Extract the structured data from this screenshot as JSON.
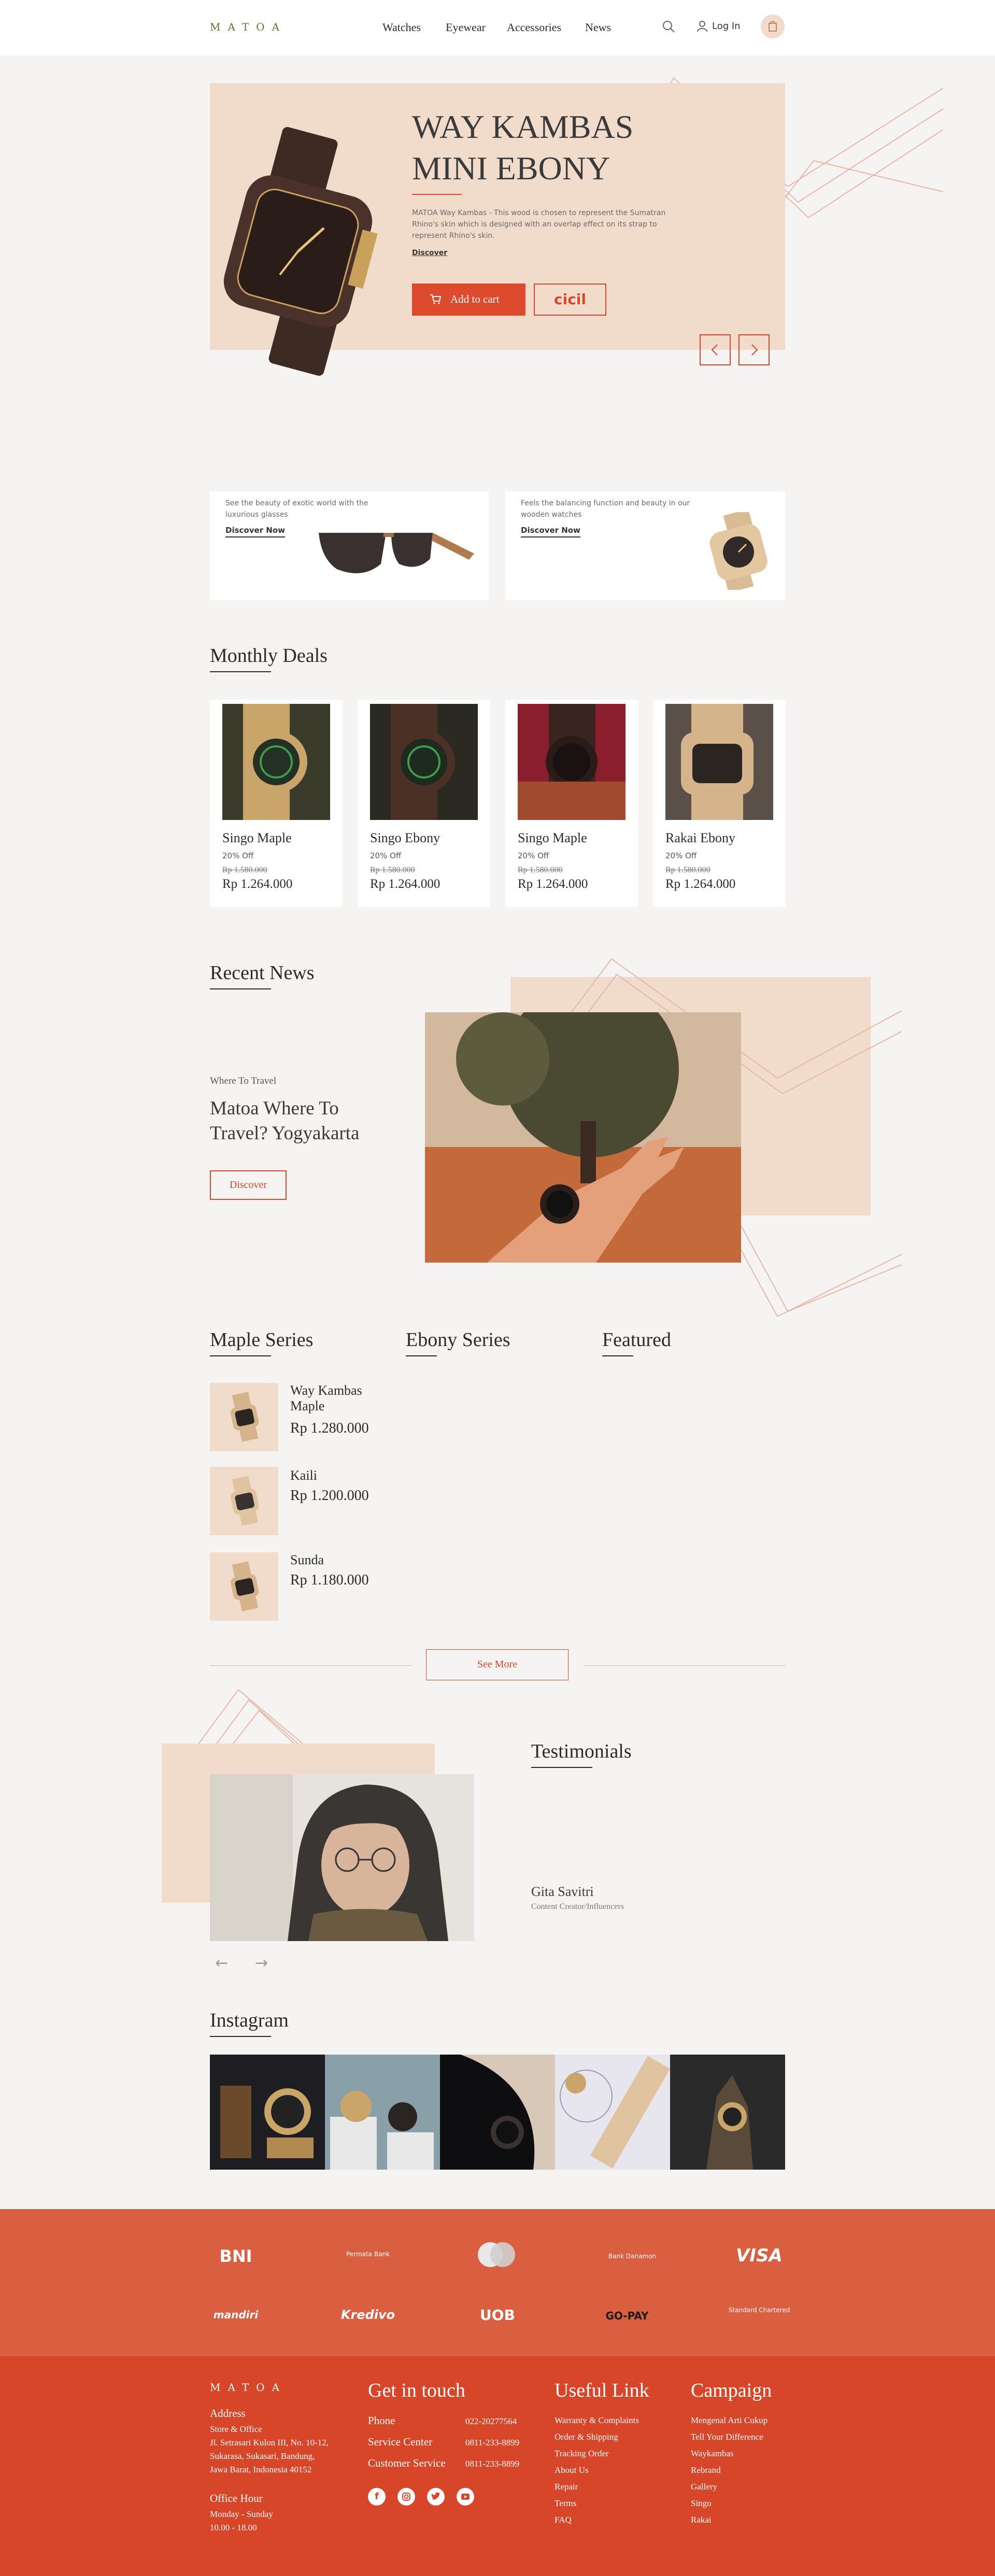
{
  "header": {
    "logo": "MATOA",
    "nav": [
      "Watches",
      "Eyewear",
      "Accessories",
      "News"
    ],
    "login": "Log In"
  },
  "hero": {
    "title_line1": "WAY KAMBAS",
    "title_line2": "MINI EBONY",
    "description": "MATOA Way Kambas - This wood is chosen to represent the Sumatran Rhino's skin which is designed with an overlap effect on its strap to represent Rhino's skin.",
    "discover": "Discover",
    "add_to_cart": "Add to cart",
    "cicil": "cicil"
  },
  "promos": [
    {
      "text": "See the beauty of exotic world with the luxurious glasses",
      "link": "Discover Now"
    },
    {
      "text": "Feels the balancing function and beauty in our wooden watches",
      "link": "Discover Now"
    }
  ],
  "monthly_deals": {
    "title": "Monthly Deals",
    "items": [
      {
        "name": "Singo Maple",
        "discount": "20% Off",
        "old_price": "Rp 1.580.000",
        "price": "Rp 1.264.000"
      },
      {
        "name": "Singo Ebony",
        "discount": "20% Off",
        "old_price": "Rp 1.580.000",
        "price": "Rp 1.264.000"
      },
      {
        "name": "Singo Maple",
        "discount": "20% Off",
        "old_price": "Rp 1.580.000",
        "price": "Rp 1.264.000"
      },
      {
        "name": "Rakai Ebony",
        "discount": "20% Off",
        "old_price": "Rp 1.580.000",
        "price": "Rp 1.264.000"
      }
    ]
  },
  "news": {
    "title": "Recent News",
    "category": "Where To Travel",
    "headline_line1": "Matoa Where To",
    "headline_line2": "Travel? Yogyakarta",
    "button": "Discover"
  },
  "series": {
    "columns": [
      "Maple Series",
      "Ebony Series",
      "Featured"
    ],
    "items": [
      {
        "name_line1": "Way Kambas",
        "name_line2": "Maple",
        "price": "Rp 1.280.000"
      },
      {
        "name_line1": "Kaili",
        "name_line2": "",
        "price": "Rp 1.200.000"
      },
      {
        "name_line1": "Sunda",
        "name_line2": "",
        "price": "Rp 1.180.000"
      }
    ],
    "see_more": "See More"
  },
  "testimonials": {
    "title": "Testimonials",
    "name": "Gita Savitri",
    "role": "Content Creator/Influencers",
    "prev": "←",
    "next": "→"
  },
  "instagram": {
    "title": "Instagram"
  },
  "partners": {
    "row1": [
      "BNI",
      "Permata Bank",
      "MasterCard",
      "Bank Danamon",
      "VISA"
    ],
    "row2": [
      "mandiri",
      "Kredivo",
      "UOB",
      "GO-PAY",
      "Standard Chartered"
    ]
  },
  "footer": {
    "logo": "MATOA",
    "address_title": "Address",
    "address_lines": [
      "Store & Office",
      "Jl. Setrasari Kulon III, No. 10-12,",
      "Sukarasa, Sukasari, Bandung,",
      "Jawa Barat, Indonesia 40152"
    ],
    "office_title": "Office Hour",
    "office_lines": [
      "Monday - Sunday",
      "10.00 - 18.00"
    ],
    "contact_title": "Get in touch",
    "contacts": [
      {
        "label": "Phone",
        "value": "022-20277564"
      },
      {
        "label": "Service Center",
        "value": "0811-233-8899"
      },
      {
        "label": "Customer Service",
        "value": "0811-233-8899"
      }
    ],
    "useful_title": "Useful Link",
    "useful": [
      "Warranty & Complaints",
      "Order & Shipping",
      "Tracking Order",
      "About Us",
      "Repair",
      "Terms",
      "FAQ"
    ],
    "campaign_title": "Campaign",
    "campaign": [
      "Mengenal Arti Cukup",
      "Tell Your Difference",
      "Waykambas",
      "Rebrand",
      "Gallery",
      "Singo",
      "Rakai"
    ]
  },
  "colors": {
    "accent": "#de4a2d",
    "peach": "#f1dccc",
    "footer": "#d8462a",
    "partner_band": "#d95f40",
    "logo": "#6d6a38"
  }
}
